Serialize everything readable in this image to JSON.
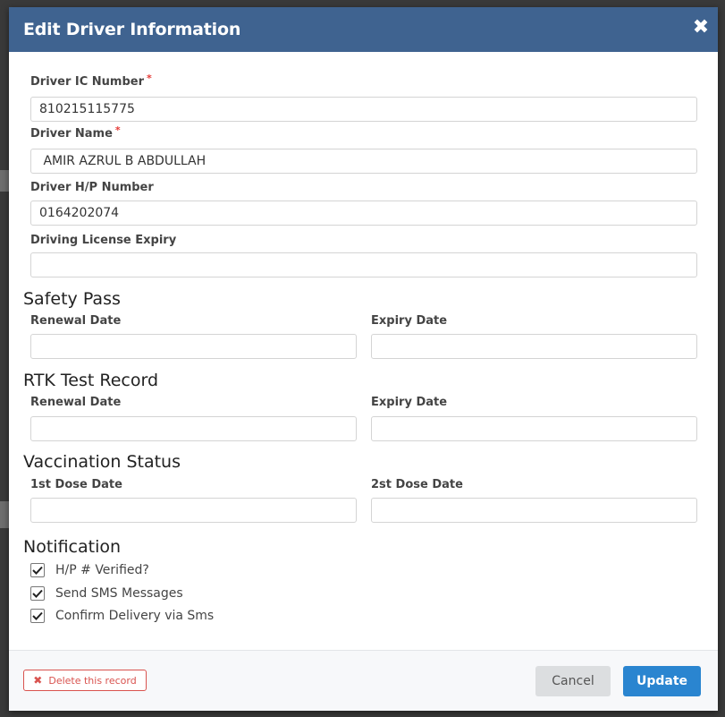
{
  "modal": {
    "title": "Edit Driver Information",
    "close_label": "✖"
  },
  "fields": {
    "ic_number": {
      "label": "Driver IC Number",
      "required": "*",
      "value": "810215115775"
    },
    "name": {
      "label": "Driver Name",
      "required": "*",
      "value": " AMIR AZRUL B ABDULLAH"
    },
    "hp_number": {
      "label": "Driver H/P Number",
      "value": "0164202074"
    },
    "license_expiry": {
      "label": "Driving License Expiry",
      "value": ""
    }
  },
  "safety_pass": {
    "heading": "Safety Pass",
    "renewal_label": "Renewal Date",
    "renewal_value": "",
    "expiry_label": "Expiry Date",
    "expiry_value": ""
  },
  "rtk_test": {
    "heading": "RTK Test Record",
    "renewal_label": "Renewal Date",
    "renewal_value": "",
    "expiry_label": "Expiry Date",
    "expiry_value": ""
  },
  "vaccination": {
    "heading": "Vaccination Status",
    "dose1_label": "1st Dose Date",
    "dose1_value": "",
    "dose2_label": "2st Dose Date",
    "dose2_value": ""
  },
  "notification": {
    "heading": "Notification",
    "options": [
      {
        "label": "H/P # Verified?",
        "checked": true
      },
      {
        "label": "Send SMS Messages",
        "checked": true
      },
      {
        "label": "Confirm Delivery via Sms",
        "checked": true
      }
    ]
  },
  "footer": {
    "delete_label": "Delete this record",
    "delete_icon": "✖",
    "cancel_label": "Cancel",
    "update_label": "Update"
  },
  "colors": {
    "header": "#3f6390",
    "primary": "#2a85d0",
    "danger": "#d9534f",
    "required": "#e53935"
  }
}
